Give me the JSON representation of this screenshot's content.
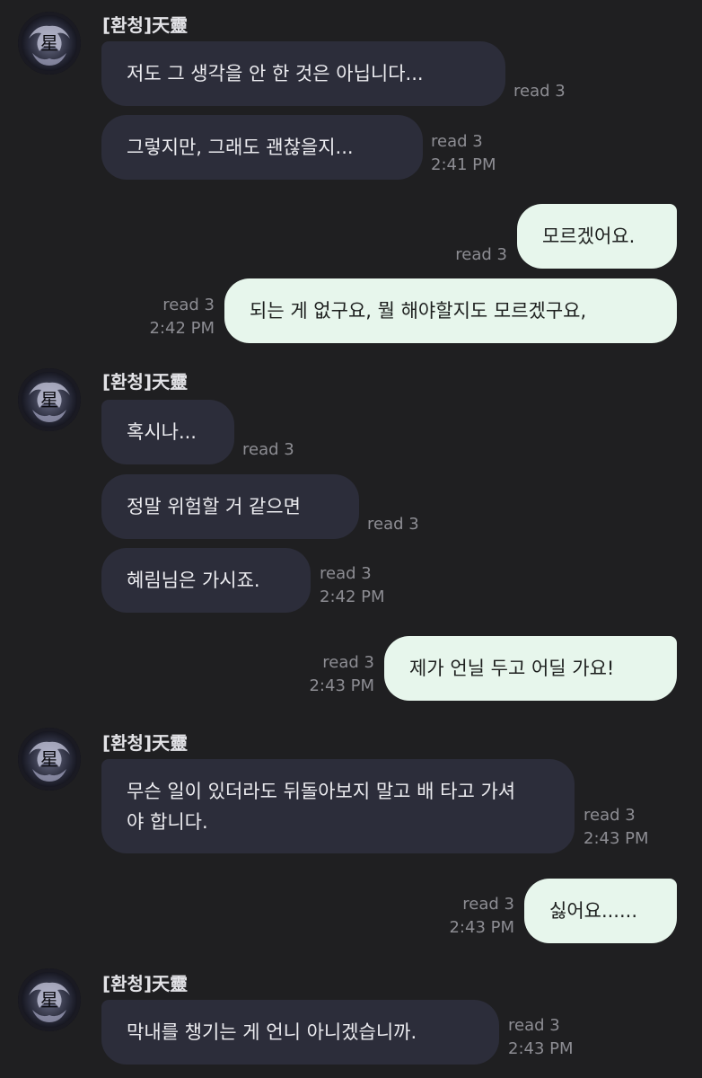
{
  "chat": {
    "sender_name": "[환청]天靈",
    "groups": [
      {
        "messages": [
          {
            "text": "저도 그 생각을 안 한 것은 아닙니다...",
            "read": "read 3"
          },
          {
            "text": "그렇지만, 그래도 괜찮을지...",
            "read": "read 3",
            "time": "2:41 PM"
          }
        ]
      },
      {
        "messages": [
          {
            "text": "정말 위험할 거 같으면",
            "read": "read 3"
          },
          {
            "text": "혹시나...",
            "read": "read 3"
          },
          {
            "text": "혜림님은 가시죠.",
            "read": "read 3",
            "time": "2:42 PM"
          }
        ]
      },
      {
        "messages": [
          {
            "text": "무슨 일이 있더라도 뒤돌아보지 말고 배 타고 가셔야 합니다.",
            "read": "read 3",
            "time": "2:43 PM"
          }
        ]
      },
      {
        "messages": [
          {
            "text": "막내를 챙기는 게 언니 아니겠습니까.",
            "read": "read 3",
            "time": "2:43 PM"
          }
        ]
      }
    ],
    "outgoing": [
      {
        "text": "모르겠어요.",
        "read": "read 3"
      },
      {
        "text": "되는 게 없구요, 뭘 해야할지도 모르겠구요,",
        "read": "read 3",
        "time": "2:42 PM"
      },
      {
        "text": "제가 언닐 두고 어딜 가요!",
        "read": "read 3",
        "time": "2:43 PM"
      },
      {
        "text": "싫어요......",
        "read": "read 3",
        "time": "2:43 PM"
      }
    ]
  }
}
